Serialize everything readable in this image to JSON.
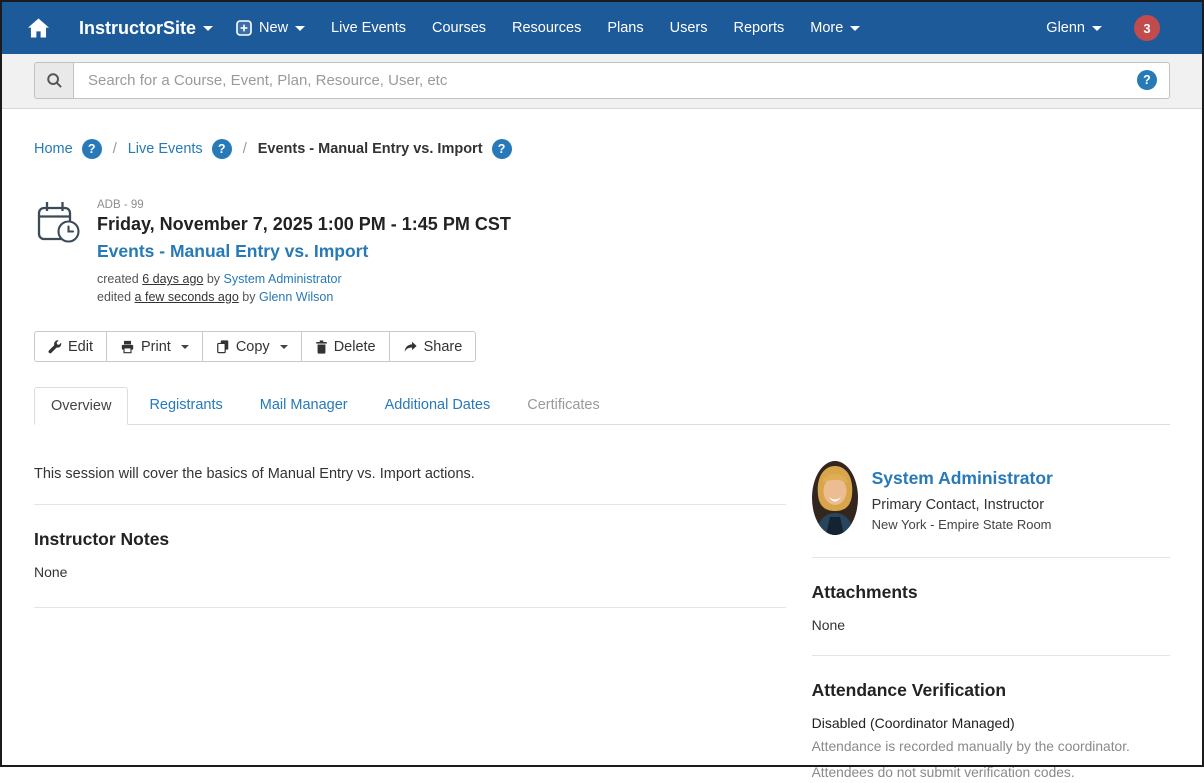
{
  "nav": {
    "brand": "InstructorSite",
    "items": [
      {
        "label": "New"
      },
      {
        "label": "Live Events"
      },
      {
        "label": "Courses"
      },
      {
        "label": "Resources"
      },
      {
        "label": "Plans"
      },
      {
        "label": "Users"
      },
      {
        "label": "Reports"
      },
      {
        "label": "More"
      }
    ],
    "user": "Glenn",
    "notification_count": "3"
  },
  "search": {
    "placeholder": "Search for a Course, Event, Plan, Resource, User, etc"
  },
  "icons": {
    "help_glyph": "?"
  },
  "breadcrumb": {
    "separator": "/",
    "items": [
      {
        "label": "Home"
      },
      {
        "label": "Live Events"
      },
      {
        "label": "Events - Manual Entry vs. Import"
      }
    ]
  },
  "event": {
    "code": "ADB - 99",
    "datetime": "Friday, November 7, 2025 1:00 PM - 1:45 PM CST",
    "title": "Events - Manual Entry vs. Import",
    "created_prefix": "created",
    "created_time": "6 days ago",
    "created_by_word": "by",
    "created_by": "System Administrator",
    "edited_prefix": "edited",
    "edited_time": "a few seconds ago",
    "edited_by_word": "by",
    "edited_by": "Glenn Wilson"
  },
  "toolbar": {
    "buttons": [
      "Edit",
      "Print",
      "Copy",
      "Delete",
      "Share"
    ]
  },
  "tabs": {
    "items": [
      "Overview",
      "Registrants",
      "Mail Manager",
      "Additional Dates",
      "Certificates"
    ],
    "active": "Overview"
  },
  "overview": {
    "description": "This session will cover the basics of Manual Entry vs. Import actions.",
    "instructor_notes_title": "Instructor Notes",
    "instructor_notes_value": "None"
  },
  "contact": {
    "name": "System Administrator",
    "roles": "Primary Contact, Instructor",
    "location": "New York - Empire State Room"
  },
  "attachments": {
    "title": "Attachments",
    "value": "None"
  },
  "attendance": {
    "title": "Attendance Verification",
    "status": "Disabled (Coordinator Managed)",
    "line1": "Attendance is recorded manually by the coordinator.",
    "line2": "Attendees do not submit verification codes."
  },
  "colors": {
    "nav_blue": "#1d5a99",
    "link_blue": "#2779b7",
    "badge_red": "#c24b4e"
  }
}
